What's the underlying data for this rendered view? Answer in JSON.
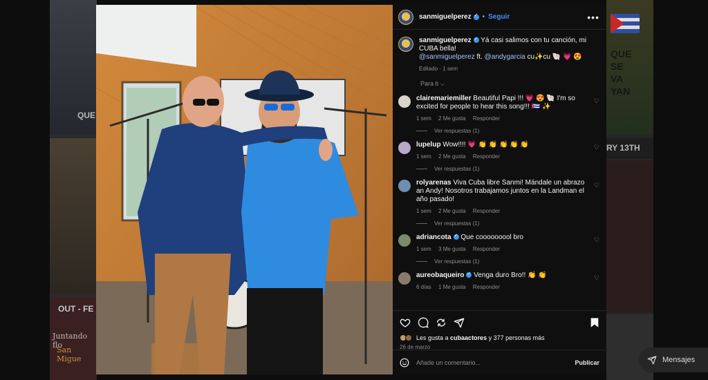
{
  "background": {
    "left_labels": [
      "QUE",
      "OUT - FE",
      "Juntando flo",
      "San Migue"
    ],
    "right_labels": [
      "QUE",
      "SE",
      "VA",
      "YAN",
      "RY 13TH"
    ],
    "messages_label": "Mensajes"
  },
  "post": {
    "username": "sanmiguelperez",
    "follow_label": "Seguir",
    "more_label": "•••",
    "caption_text": "Yá casi salimos con tu canción, mi CUBA bella!",
    "caption_mention1": "@sanmiguelperez",
    "caption_ft": " ft. ",
    "caption_mention2": "@andygarcia",
    "caption_tail": " cu✨cu 🐚 💗 😍",
    "caption_meta": "Editado · 1 sem",
    "para_ti": "Para ti ⌵"
  },
  "comments": [
    {
      "user": "clairemariemiller",
      "verified": false,
      "text": "Beautiful Papi !!! 💗 😍 🐚 I'm so excited for people to hear this song!!! 🇨🇺 ✨",
      "time": "1 sem",
      "likes": "2 Me gusta",
      "reply": "Responder",
      "replies": "Ver respuestas (1)",
      "avatar_color": "#d9d4c8"
    },
    {
      "user": "lupelup",
      "verified": false,
      "text": "Wow!!!! 💗 👏 👏 👏 👏 👏",
      "time": "1 sem",
      "likes": "2 Me gusta",
      "reply": "Responder",
      "replies": "Ver respuestas (1)",
      "avatar_color": "#b9a8c9"
    },
    {
      "user": "rolyarenas",
      "verified": false,
      "text": "Viva Cuba libre Sanmi! Mándale un abrazo an Andy! Nosotros trabajamos juntos en la Landman el año pasado!",
      "time": "1 sem",
      "likes": "2 Me gusta",
      "reply": "Responder",
      "replies": "Ver respuestas (1)",
      "avatar_color": "#6f8fb0"
    },
    {
      "user": "adriancota",
      "verified": true,
      "text": "Que cooooooool bro",
      "time": "1 sem",
      "likes": "3 Me gusta",
      "reply": "Responder",
      "replies": "Ver respuestas (1)",
      "avatar_color": "#7a8a6a"
    },
    {
      "user": "aureobaqueiro",
      "verified": true,
      "text": "Venga duro Bro!! 👏 👏",
      "time": "6 días",
      "likes": "1 Me gusta",
      "reply": "Responder",
      "replies": "",
      "avatar_color": "#8a7a6a"
    }
  ],
  "actions": {
    "likes_prefix": "Les gusta a ",
    "likes_user": "cubaactores",
    "likes_suffix": " y 377 personas más",
    "date": "26 de marzo",
    "comment_placeholder": "Añade un comentario...",
    "publish_label": "Publicar"
  },
  "colors": {
    "accent_blue": "#4a90f5",
    "panel_bg": "#0f0f0f",
    "heart_red": "#ff3040"
  }
}
